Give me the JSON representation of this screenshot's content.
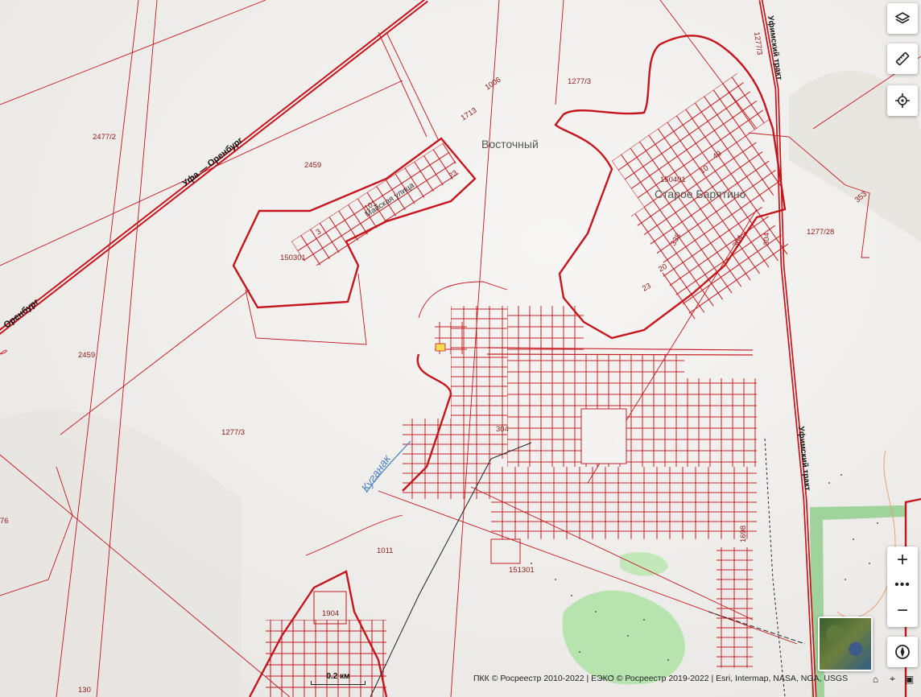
{
  "map": {
    "labels": {
      "vostochny": "Восточный",
      "staroe_baryatino": "Старое Барятино",
      "ufa_orenburg_1": "Уфа — Оренбург",
      "ufa_orenburg_2": "Оренбург",
      "ufimsky_trakt_1": "Уфимский тракт",
      "ufimsky_trakt_2": "Уфимский тракт",
      "mayskaya": "Майская улица",
      "kuganak": "Куганак"
    },
    "parcels": {
      "p1277_3_top": "1277/3",
      "p2477_2": "2477/2",
      "p2459_a": "2459",
      "p2459_b": "2459",
      "p1277_3_mid": "1277/3",
      "p150301": "150301",
      "p150401": "150401",
      "p1713": "1713",
      "p1006": "1006",
      "p1277_3_right": "1277/3",
      "p304_a": "304",
      "p304_b": "304",
      "p304_c": "304",
      "p1277_28": "1277/28",
      "p353": "353",
      "p1011": "1011",
      "p151301": "151301",
      "p1698": "1698",
      "p1904": "1904",
      "p130": "130",
      "p76": "76",
      "n49": "49",
      "n10": "10",
      "n338": "338",
      "n20": "20",
      "n23a": "23",
      "n23b": "23",
      "n101": "101",
      "n3": "3"
    }
  },
  "scale": {
    "label": "0.2 км"
  },
  "attribution": "ПКК © Росреестр 2010-2022 | ЕЭКО © Росреестр 2019-2022 | Esri, Intermap, NASA, NGA, USGS",
  "controls": {
    "layers_icon": "layers-icon",
    "ruler_icon": "ruler-icon",
    "locate_icon": "crosshair-icon",
    "zoom_in": "+",
    "zoom_more": "•••",
    "zoom_out": "−",
    "compass_icon": "compass-icon"
  },
  "colors": {
    "parcel_red": "#c4161c",
    "water": "#4a7fc1",
    "green": "#a8dca0",
    "bg": "#f3f1ef"
  }
}
